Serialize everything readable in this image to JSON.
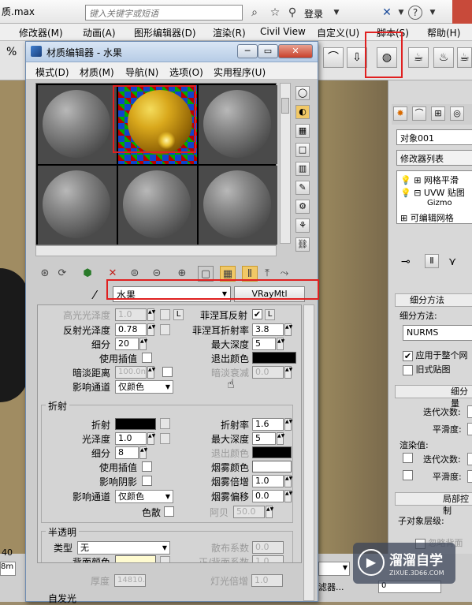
{
  "app": {
    "file_title": "质.max",
    "search_placeholder": "键入关键字或短语",
    "login_label": "登录",
    "help_label": "?"
  },
  "main_menu": [
    "修改器(M)",
    "动画(A)",
    "图形编辑器(D)",
    "渲染(R)",
    "Civil View",
    "自定义(U)",
    "脚本(S)",
    "帮助(H)"
  ],
  "material_editor": {
    "title": "材质编辑器 - 水果",
    "menu": [
      "模式(D)",
      "材质(M)",
      "导航(N)",
      "选项(O)",
      "实用程序(U)"
    ],
    "material_name": "水果",
    "material_type": "VRayMtl",
    "reflection": {
      "hilight_gloss_label": "高光光泽度",
      "hilight_gloss_value": "1.0",
      "lock_label": "L",
      "fresnel_label": "菲涅耳反射",
      "fresnel_checked": "✔",
      "refl_gloss_label": "反射光泽度",
      "refl_gloss_value": "0.78",
      "fresnel_ior_label": "菲涅耳折射率",
      "fresnel_ior_value": "3.8",
      "subdivs_label": "细分",
      "subdivs_value": "20",
      "max_depth_label": "最大深度",
      "max_depth_value": "5",
      "use_interp_label": "使用插值",
      "exit_color_label": "退出颜色",
      "dim_distance_label": "暗淡距离",
      "dim_distance_value": "100.0n",
      "dim_falloff_label": "暗淡衰减",
      "dim_falloff_value": "0.0",
      "affect_channels_label": "影响通道",
      "affect_channels_value": "仅颜色"
    },
    "refraction": {
      "group_title": "折射",
      "refract_label": "折射",
      "ior_label": "折射率",
      "ior_value": "1.6",
      "gloss_label": "光泽度",
      "gloss_value": "1.0",
      "max_depth_label": "最大深度",
      "max_depth_value": "5",
      "subdivs_label": "细分",
      "subdivs_value": "8",
      "exit_color_label": "退出颜色",
      "use_interp_label": "使用插值",
      "fog_color_label": "烟雾颜色",
      "affect_shadows_label": "影响阴影",
      "fog_mult_label": "烟雾倍增",
      "fog_mult_value": "1.0",
      "affect_channels_label": "影响通道",
      "affect_channels_value": "仅颜色",
      "fog_bias_label": "烟雾偏移",
      "fog_bias_value": "0.0",
      "dispersion_label": "色散",
      "abbe_label": "阿贝",
      "abbe_value": "50.0"
    },
    "translucency": {
      "group_title": "半透明",
      "type_label": "类型",
      "type_value": "无",
      "scatter_coef_label": "散布系数",
      "scatter_coef_value": "0.0",
      "back_color_label": "背面颜色",
      "fwd_back_label": "正/背面系数",
      "fwd_back_value": "1.0",
      "thickness_label": "厚度",
      "thickness_value": "14810.",
      "light_mult_label": "灯光倍增",
      "light_mult_value": "1.0"
    },
    "self_illum_title": "自发光"
  },
  "command_panel": {
    "object_name": "对象001",
    "modifier_list_label": "修改器列表",
    "stack": [
      "网格平滑",
      "UVW 贴图",
      "Gizmo",
      "可编辑网格"
    ],
    "subdiv_method_title": "细分方法",
    "subdiv_method_label": "细分方法:",
    "subdiv_method_value": "NURMS",
    "apply_whole_label": "应用于整个网",
    "old_map_label": "旧式贴图",
    "subdiv_amount_title": "细分量",
    "iterations_label": "迭代次数:",
    "smoothness_label": "平滑度:",
    "render_values_label": "渲染值:",
    "render_iterations_label": "迭代次数:",
    "render_smoothness_label": "平滑度:",
    "local_control_title": "局部控制",
    "sub_level_label": "子对象层级:",
    "ignore_back_label": "忽略背面"
  },
  "bottom": {
    "filter_label": "滤器...",
    "coord_label": "0"
  },
  "watermark": {
    "name": "溜溜自学",
    "url": "ZIXUE.3D66.COM"
  },
  "colors": {
    "highlight_red": "#e02020",
    "window_blue": "#b7cce6",
    "viewport_tan": "#a08c62"
  }
}
